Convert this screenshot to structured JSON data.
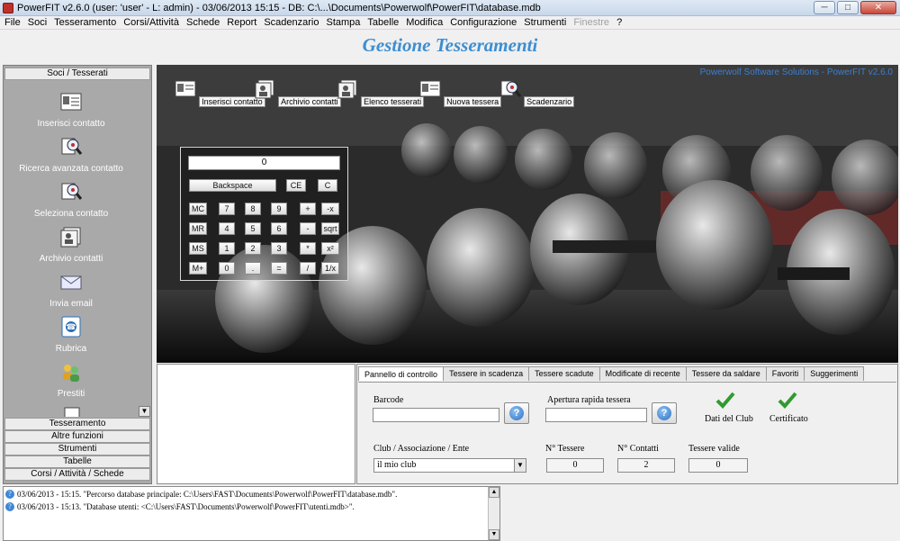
{
  "window": {
    "title": "PowerFIT v2.6.0  (user: 'user'  - L: admin) - 03/06/2013 15:15 - DB: C:\\...\\Documents\\Powerwolf\\PowerFIT\\database.mdb"
  },
  "menu": [
    "File",
    "Soci",
    "Tesseramento",
    "Corsi/Attività",
    "Schede",
    "Report",
    "Scadenzario",
    "Stampa",
    "Tabelle",
    "Modifica",
    "Configurazione",
    "Strumenti",
    "Finestre",
    "?"
  ],
  "header": {
    "title": "Gestione Tesseramenti"
  },
  "sidebar": {
    "head": "Soci / Tesserati",
    "items": [
      {
        "label": "Inserisci contatto",
        "icon": "contact-card-icon"
      },
      {
        "label": "Ricerca avanzata contatto",
        "icon": "magnifier-icon"
      },
      {
        "label": "Seleziona contatto",
        "icon": "magnifier-icon"
      },
      {
        "label": "Archivio contatti",
        "icon": "contacts-archive-icon"
      },
      {
        "label": "Invia email",
        "icon": "envelope-icon"
      },
      {
        "label": "Rubrica",
        "icon": "phone-book-icon"
      },
      {
        "label": "Prestiti",
        "icon": "users-icon"
      }
    ],
    "sections": [
      "Tesseramento",
      "Altre funzioni",
      "Strumenti",
      "Tabelle",
      "Corsi / Attività / Schede"
    ]
  },
  "banner": {
    "credit": "Powerwolf Software Solutions - PowerFIT v2.6.0",
    "toolbar": [
      "Inserisci contatto",
      "Archivio contatti",
      "Elenco tesserati",
      "Nuova tessera",
      "Scadenzario"
    ]
  },
  "calculator": {
    "display": "0",
    "backspace": "Backspace",
    "ce": "CE",
    "c": "C",
    "rows": [
      [
        "MC",
        "7",
        "8",
        "9",
        "+",
        "-x"
      ],
      [
        "MR",
        "4",
        "5",
        "6",
        "-",
        "sqrt"
      ],
      [
        "MS",
        "1",
        "2",
        "3",
        "*",
        "x²"
      ],
      [
        "M+",
        "0",
        ".",
        "=",
        "/",
        "1/x"
      ]
    ]
  },
  "panel": {
    "tabs": [
      "Pannello di controllo",
      "Tessere in scadenza",
      "Tessere scadute",
      "Modificate di recente",
      "Tessere da saldare",
      "Favoriti",
      "Suggerimenti"
    ],
    "barcode_label": "Barcode",
    "barcode_value": "",
    "apertura_label": "Apertura rapida tessera",
    "apertura_value": "",
    "help_glyph": "?",
    "dati_club": "Dati del Club",
    "certificato": "Certificato",
    "club_label": "Club / Associazione / Ente",
    "club_value": "il mio club",
    "n_tessere_label": "N° Tessere",
    "n_tessere": "0",
    "n_contatti_label": "N° Contatti",
    "n_contatti": "2",
    "tessere_valide_label": "Tessere valide",
    "tessere_valide": "0"
  },
  "log": [
    "03/06/2013 - 15:15. \"Percorso database principale: C:\\Users\\FAST\\Documents\\Powerwolf\\PowerFIT\\database.mdb\".",
    "03/06/2013 - 15:13. \"Database utenti: <C:\\Users\\FAST\\Documents\\Powerwolf\\PowerFIT\\utenti.mdb>\"."
  ]
}
